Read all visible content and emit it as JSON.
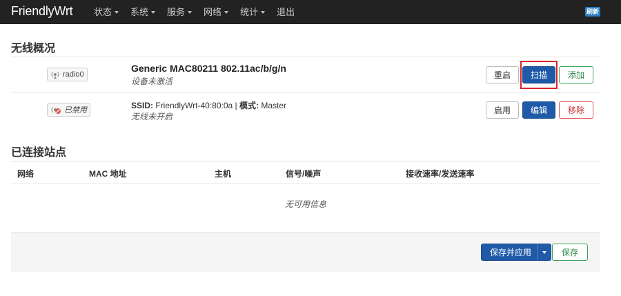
{
  "brand": "FriendlyWrt",
  "nav": [
    {
      "label": "状态",
      "has_caret": true
    },
    {
      "label": "系统",
      "has_caret": true
    },
    {
      "label": "服务",
      "has_caret": true
    },
    {
      "label": "网络",
      "has_caret": true
    },
    {
      "label": "统计",
      "has_caret": true
    },
    {
      "label": "退出",
      "has_caret": false
    }
  ],
  "refresh_badge": "刷新",
  "wireless": {
    "heading": "无线概况",
    "radio": {
      "badge": "radio0",
      "title": "Generic MAC80211 802.11ac/b/g/n",
      "status": "设备未激活",
      "buttons": {
        "restart": "重启",
        "scan": "扫描",
        "add": "添加"
      }
    },
    "network": {
      "badge": "已禁用",
      "ssid_label": "SSID:",
      "ssid_value": "FriendlyWrt-40:80:0a",
      "sep": "|",
      "mode_label": "模式:",
      "mode_value": "Master",
      "status": "无线未开启",
      "buttons": {
        "enable": "启用",
        "edit": "编辑",
        "remove": "移除"
      }
    }
  },
  "stations": {
    "heading": "已连接站点",
    "columns": [
      "网络",
      "MAC 地址",
      "主机",
      "信号/噪声",
      "接收速率/发送速率"
    ],
    "empty_message": "无可用信息"
  },
  "footer": {
    "save_apply": "保存并应用",
    "save": "保存"
  },
  "colors": {
    "primary": "#1e5aa8",
    "success": "#3fa35b",
    "danger": "#d9534f",
    "highlight": "#d9262b",
    "navbar": "#222222"
  }
}
